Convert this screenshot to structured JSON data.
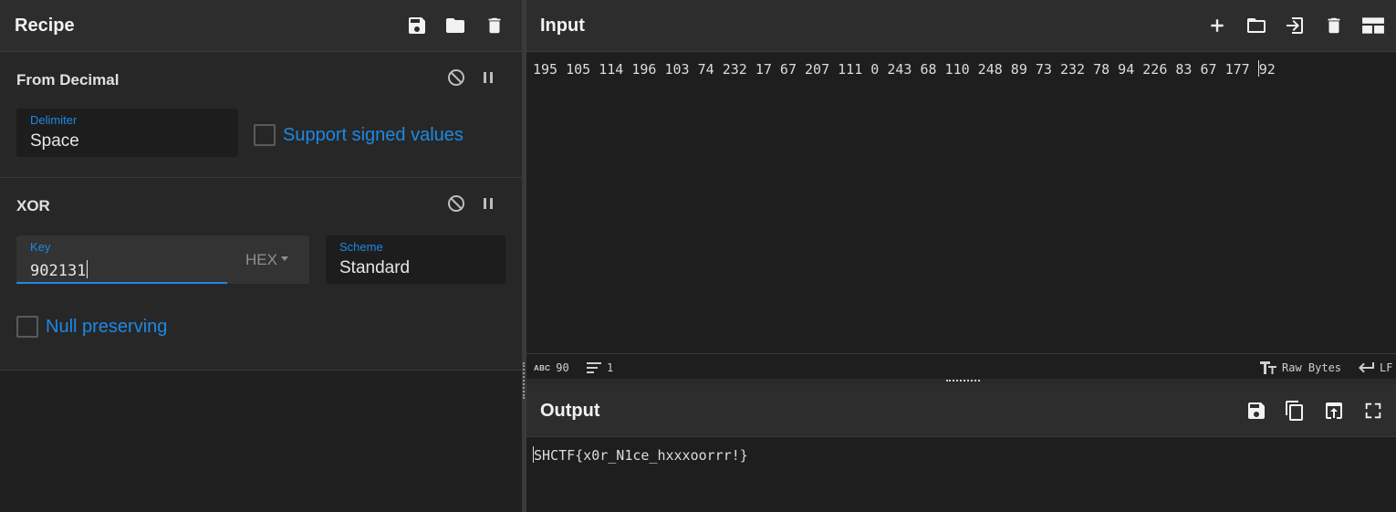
{
  "recipe": {
    "title": "Recipe",
    "icons": [
      "save-icon",
      "folder-icon",
      "trash-icon"
    ]
  },
  "operations": [
    {
      "title": "From Decimal",
      "delimiter": {
        "label": "Delimiter",
        "value": "Space"
      },
      "signed_checkbox": {
        "label": "Support signed values",
        "checked": false
      }
    },
    {
      "title": "XOR",
      "key": {
        "label": "Key",
        "value": "902131",
        "format": "HEX"
      },
      "scheme": {
        "label": "Scheme",
        "value": "Standard"
      },
      "null_checkbox": {
        "label": "Null preserving",
        "checked": false
      }
    }
  ],
  "input": {
    "title": "Input",
    "text": "195 105 114 196 103 74 232 17 67 207 111 0 243 68 110 248 89 73 232 78 94 226 83 67 177 ",
    "text_after_caret": "92",
    "icons": [
      "plus-icon",
      "folder-icon",
      "sign-in-icon",
      "trash-icon",
      "layout-icon"
    ]
  },
  "status": {
    "abc_label": "ABC",
    "char_count": "90",
    "line_count": "1",
    "encoding": "Raw Bytes",
    "eol": "LF"
  },
  "output": {
    "title": "Output",
    "text": "SHCTF{x0r_N1ce_hxxxoorrr!}",
    "icons": [
      "save-icon",
      "copy-icon",
      "replace-input-icon",
      "maximize-icon"
    ]
  },
  "colors": {
    "accent": "#1e88e5",
    "header_bg": "#2d2d2d",
    "panel_bg": "#1e1e1e"
  }
}
